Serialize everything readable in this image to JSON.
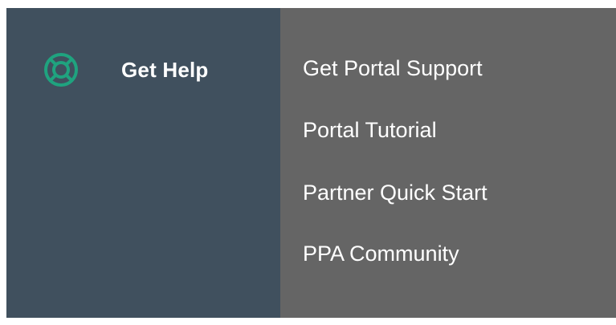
{
  "panel": {
    "title": "Get Help",
    "icon": "lifebuoy-icon",
    "accent_color": "#1fa37f"
  },
  "menu": {
    "items": [
      {
        "label": "Get Portal Support"
      },
      {
        "label": "Portal Tutorial"
      },
      {
        "label": "Partner Quick Start"
      },
      {
        "label": "PPA Community"
      }
    ]
  },
  "colors": {
    "left_panel_bg": "#40505e",
    "right_panel_bg": "#656565",
    "text": "#ffffff"
  }
}
